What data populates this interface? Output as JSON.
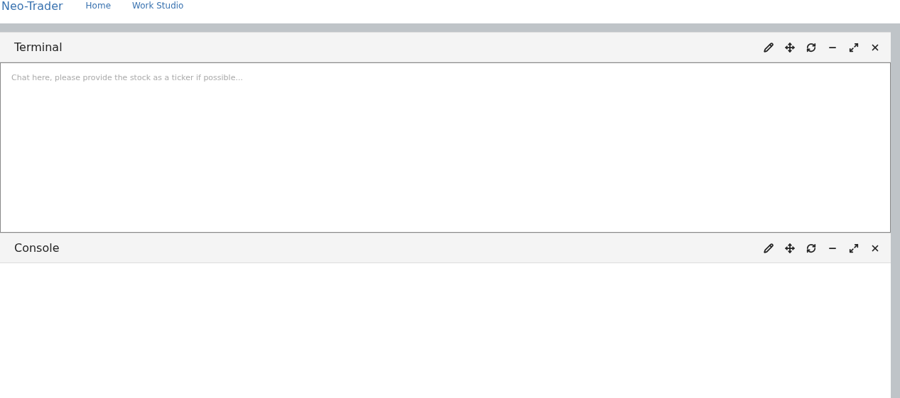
{
  "navbar": {
    "brand": "Neo-Trader",
    "links": [
      {
        "label": "Home"
      },
      {
        "label": "Work Studio"
      }
    ]
  },
  "panels": [
    {
      "kind": "terminal",
      "title": "Terminal",
      "placeholder": "Chat here, please provide the stock as a ticker if possible..."
    },
    {
      "kind": "console",
      "title": "Console"
    }
  ]
}
